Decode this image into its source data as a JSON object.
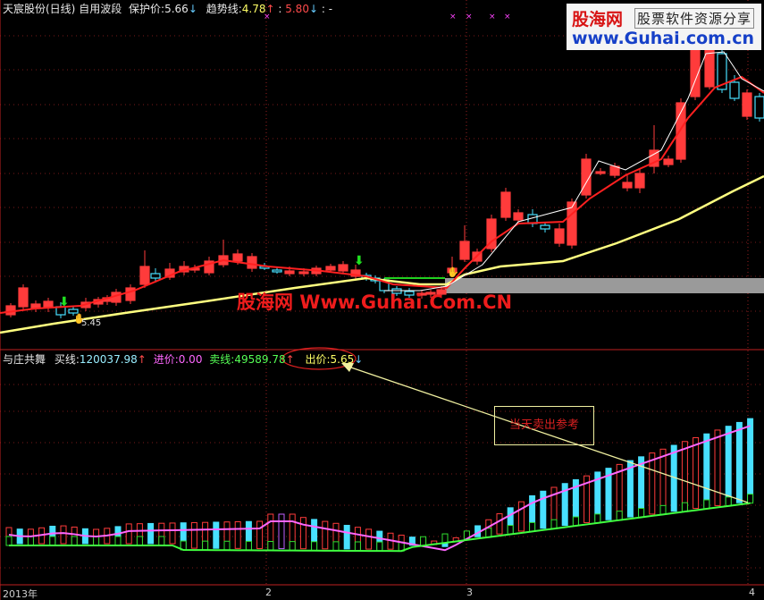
{
  "upper_panel": {
    "stock_name": "天宸股份(日线)",
    "indicator_name": "自用波段",
    "protect_label": "保护价:",
    "protect_value": "5.66",
    "protect_arrow": "↓",
    "trend_label": "趋势线:",
    "trend_value": "4.78",
    "trend_arrow": "↑",
    "sep": ":",
    "second_value": "5.80",
    "second_arrow": "↓",
    "tail": ": -",
    "low_price_label": "5.45",
    "watermark": "股海网 Www.Guhai.Com.CN"
  },
  "lower_panel": {
    "indicator_name": "与庄共舞",
    "buy_label": "买线:",
    "buy_value": "120037.98",
    "buy_arrow": "↑",
    "entry_label": "进价:",
    "entry_value": "0.00",
    "sell_label": "卖线:",
    "sell_value": "49589.78",
    "sell_arrow": "↑",
    "exit_label": "出价:",
    "exit_value": "5.65",
    "exit_arrow": "↓",
    "callout_text": "当天卖出参考"
  },
  "logo": {
    "site": "股海网",
    "slogan": "股票软件资源分享",
    "url": "www.Guhai.com.cn"
  },
  "x_axis": {
    "labels": [
      "2013年",
      "2",
      "3",
      "4"
    ]
  },
  "colors": {
    "up_candle": "#ff3b3b",
    "down_candle": "#48e0ff",
    "trend_line": "#ffff80",
    "protect_line": "#ff2020",
    "buy_line": "#ff66ff",
    "sell_line": "#40ff40"
  }
}
